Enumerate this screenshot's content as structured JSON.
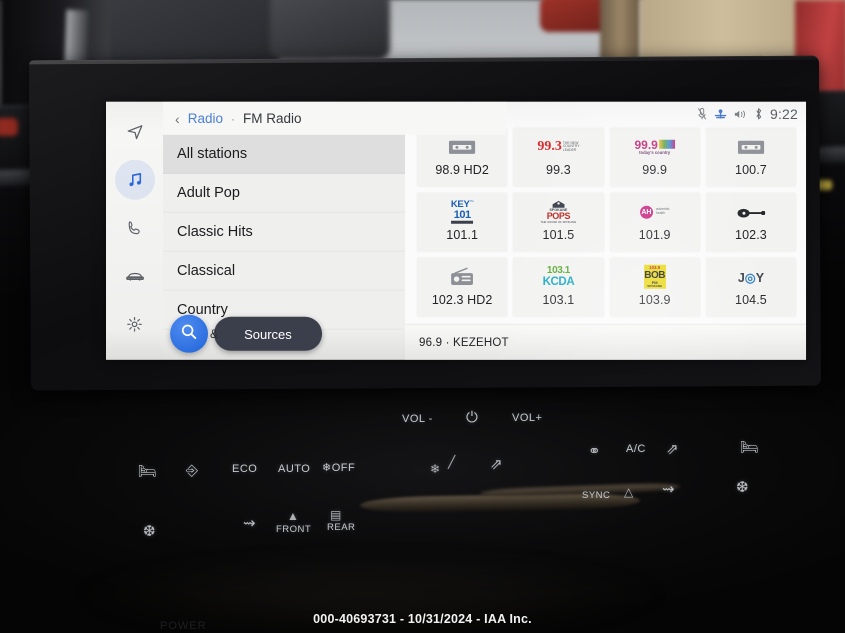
{
  "background": {
    "description": "blurred salvage-yard scene viewed through vehicle windshield"
  },
  "statusbar": {
    "time": "9:22",
    "icons": [
      "microphone-muted-icon",
      "assistant-icon",
      "volume-icon",
      "bluetooth-icon"
    ]
  },
  "breadcrumb": {
    "back": "‹",
    "parent": "Radio",
    "separator": "·",
    "current": "FM Radio"
  },
  "sidebar": {
    "items": [
      {
        "name": "navigation",
        "icon": "navigation-arrow-icon",
        "active": false
      },
      {
        "name": "media",
        "icon": "music-note-icon",
        "active": true
      },
      {
        "name": "phone",
        "icon": "phone-icon",
        "active": false
      },
      {
        "name": "vehicle",
        "icon": "car-icon",
        "active": false
      },
      {
        "name": "settings",
        "icon": "gear-icon",
        "active": false
      }
    ]
  },
  "categories": {
    "items": [
      {
        "label": "All stations",
        "selected": true
      },
      {
        "label": "Adult Pop",
        "selected": false
      },
      {
        "label": "Classic Hits",
        "selected": false
      },
      {
        "label": "Classical",
        "selected": false
      },
      {
        "label": "Country",
        "selected": false
      }
    ]
  },
  "stations": [
    {
      "freq": "98.9 HD2",
      "logo_type": "cassette-icon",
      "logo_text": "",
      "logo_color": "#8d9096"
    },
    {
      "freq": "99.3",
      "logo_type": "text",
      "logo_text": "99.3",
      "logo_color": "#d6262b"
    },
    {
      "freq": "99.9",
      "logo_type": "text",
      "logo_text": "99.9",
      "logo_color": "#c0307a"
    },
    {
      "freq": "100.7",
      "logo_type": "cassette-icon",
      "logo_text": "",
      "logo_color": "#8d9096"
    },
    {
      "freq": "101.1",
      "logo_type": "text",
      "logo_text": "KEY 101",
      "logo_color": "#1a5fb4"
    },
    {
      "freq": "101.5",
      "logo_type": "text",
      "logo_text": "POPS",
      "logo_color": "#b9281f"
    },
    {
      "freq": "101.9",
      "logo_type": "text",
      "logo_text": "AH",
      "logo_color": "#cc2e86"
    },
    {
      "freq": "102.3",
      "logo_type": "guitar-icon",
      "logo_text": "",
      "logo_color": "#232529"
    },
    {
      "freq": "102.3 HD2",
      "logo_type": "radio-icon",
      "logo_text": "",
      "logo_color": "#8d9096"
    },
    {
      "freq": "103.1",
      "logo_type": "text",
      "logo_text": "KCDA",
      "logo_color": "#1aa7c4"
    },
    {
      "freq": "103.9",
      "logo_type": "text",
      "logo_text": "BOB",
      "logo_color": "#e8d81b"
    },
    {
      "freq": "104.5",
      "logo_type": "text",
      "logo_text": "JOY",
      "logo_color": "#3d4046"
    }
  ],
  "now_playing": {
    "text": "96.9 · KEZEHOT"
  },
  "floating_controls": {
    "search_icon": "search-icon",
    "ampersand": "&",
    "sources_label": "Sources"
  },
  "console": {
    "vol_down": "VOL -",
    "vol_up": "VOL+",
    "power_icon": "⏻",
    "eco": "ECO",
    "auto": "AUTO",
    "off": "❄OFF",
    "front_defrost": "FRONT",
    "rear_defrost": "REAR",
    "ac": "A/C",
    "sync": "SYNC",
    "power_label": "POWER"
  },
  "watermark": {
    "text": "000-40693731 - 10/31/2024 - IAA Inc."
  }
}
